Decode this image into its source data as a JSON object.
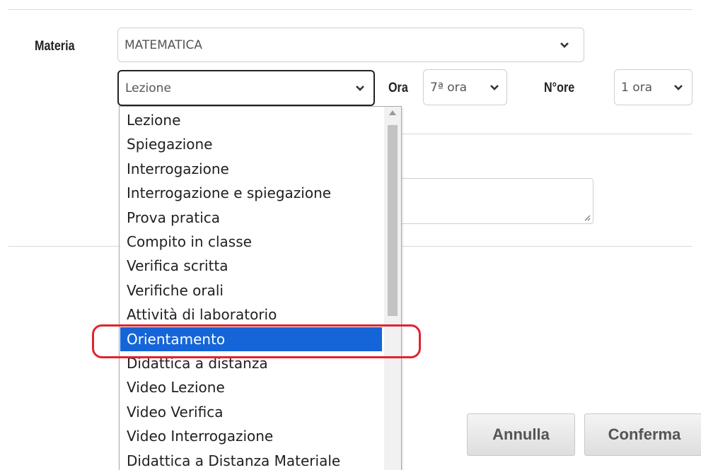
{
  "materia": {
    "label": "Materia",
    "value": "MATEMATICA"
  },
  "tipo": {
    "value": "Lezione"
  },
  "ora": {
    "label": "Ora",
    "value": "7ª ora"
  },
  "nore": {
    "label": "N°ore",
    "value": "1 ora"
  },
  "dropdown": {
    "options": [
      "Lezione",
      "Spiegazione",
      "Interrogazione",
      "Interrogazione e spiegazione",
      "Prova pratica",
      "Compito in classe",
      "Verifica scritta",
      "Verifiche orali",
      "Attività di laboratorio",
      "Orientamento",
      "Didattica a distanza",
      "Video Lezione",
      "Video Verifica",
      "Video Interrogazione",
      "Didattica a Distanza Materiale"
    ],
    "selected": "Orientamento"
  },
  "buttons": {
    "annulla": "Annulla",
    "conferma": "Conferma"
  },
  "colors": {
    "selection": "#1565d8",
    "highlight_ring": "#e0242e"
  }
}
